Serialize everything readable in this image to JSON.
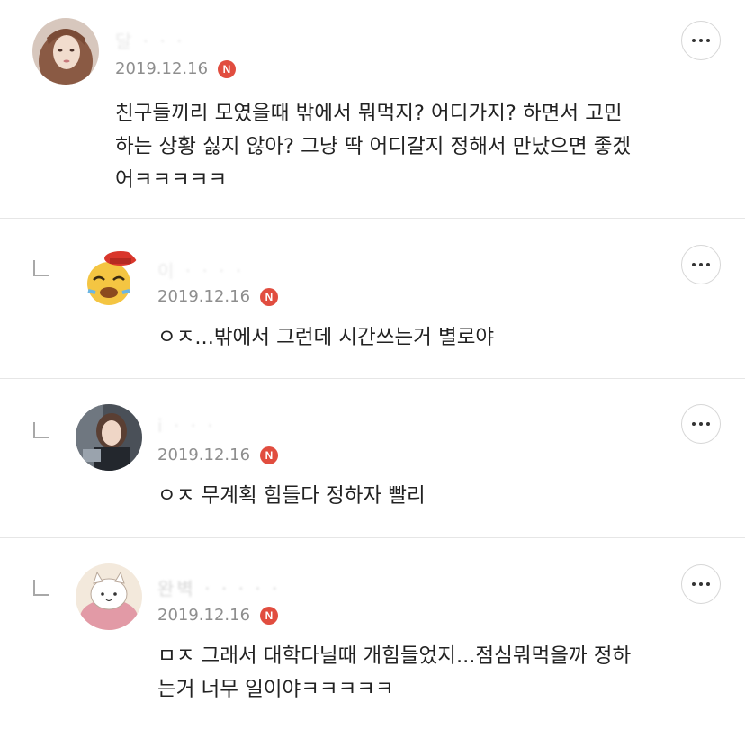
{
  "comments": [
    {
      "username": "달 · · ·",
      "date": "2019.12.16",
      "badge": "N",
      "text": "친구들끼리 모였을때 밖에서 뭐먹지? 어디가지? 하면서 고민\n하는 상황 싫지 않아? 그냥 딱 어디갈지 정해서 만났으면 좋겠\n어ㅋㅋㅋㅋㅋ",
      "is_reply": false
    },
    {
      "username": "이 · · · ·",
      "date": "2019.12.16",
      "badge": "N",
      "text": "ㅇㅈ...밖에서 그런데 시간쓰는거 별로야",
      "is_reply": true
    },
    {
      "username": "i · · ·",
      "date": "2019.12.16",
      "badge": "N",
      "text": "ㅇㅈ 무계획 힘들다 정하자 빨리",
      "is_reply": true
    },
    {
      "username": "완벽 · · · · ·",
      "date": "2019.12.16",
      "badge": "N",
      "text": "ㅁㅈ 그래서 대학다닐때 개힘들었지...점심뭐먹을까 정하\n는거 너무 일이야ㅋㅋㅋㅋㅋ",
      "is_reply": true
    }
  ],
  "colors": {
    "badge": "#e14d3f",
    "date": "#8e8e8e",
    "divider": "#e6e6e6",
    "text": "#222222"
  },
  "icons": {
    "more": "more-horizontal-icon",
    "reply": "reply-arrow-icon",
    "new_badge": "new-badge-icon"
  }
}
